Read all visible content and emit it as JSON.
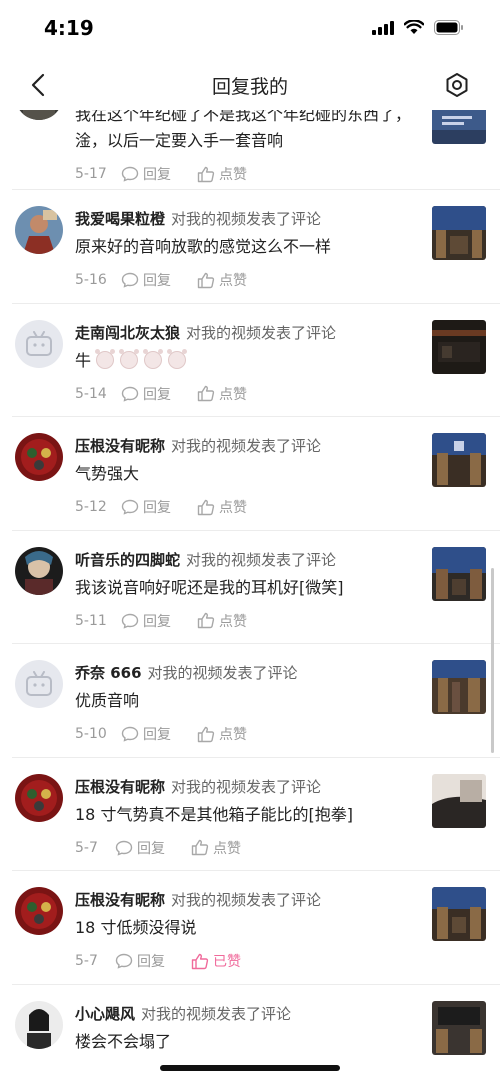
{
  "status": {
    "time": "4:19"
  },
  "header": {
    "title": "回复我的"
  },
  "labels": {
    "reply": "回复",
    "like": "点赞",
    "liked": "已赞"
  },
  "comments": [
    {
      "username": "",
      "action": "",
      "text": "我在这个年纪碰了不是我这个年纪碰的东西了，淦，以后一定要入手一套音响",
      "date": "5-17",
      "liked": false
    },
    {
      "username": "我爱喝果粒橙",
      "action": "对我的视频发表了评论",
      "text": "原来好的音响放歌的感觉这么不一样",
      "date": "5-16",
      "liked": false
    },
    {
      "username": "走南闯北灰太狼",
      "action": "对我的视频发表了评论",
      "text": "牛",
      "date": "5-14",
      "liked": false
    },
    {
      "username": "压根没有昵称",
      "action": "对我的视频发表了评论",
      "text": "气势强大",
      "date": "5-12",
      "liked": false
    },
    {
      "username": "听音乐的四脚蛇",
      "action": "对我的视频发表了评论",
      "text": "我该说音响好呢还是我的耳机好[微笑]",
      "date": "5-11",
      "liked": false
    },
    {
      "username": "乔奈 666",
      "action": "对我的视频发表了评论",
      "text": "优质音响",
      "date": "5-10",
      "liked": false
    },
    {
      "username": "压根没有昵称",
      "action": "对我的视频发表了评论",
      "text": "18 寸气势真不是其他箱子能比的[抱拳]",
      "date": "5-7",
      "liked": false
    },
    {
      "username": "压根没有昵称",
      "action": "对我的视频发表了评论",
      "text": "18 寸低频没得说",
      "date": "5-7",
      "liked": true
    },
    {
      "username": "小心飓风",
      "action": "对我的视频发表了评论",
      "text": "楼会不会塌了",
      "date": "",
      "liked": false
    }
  ],
  "colors": {
    "liked": "#f06a9b",
    "muted": "#9a9a9a"
  }
}
